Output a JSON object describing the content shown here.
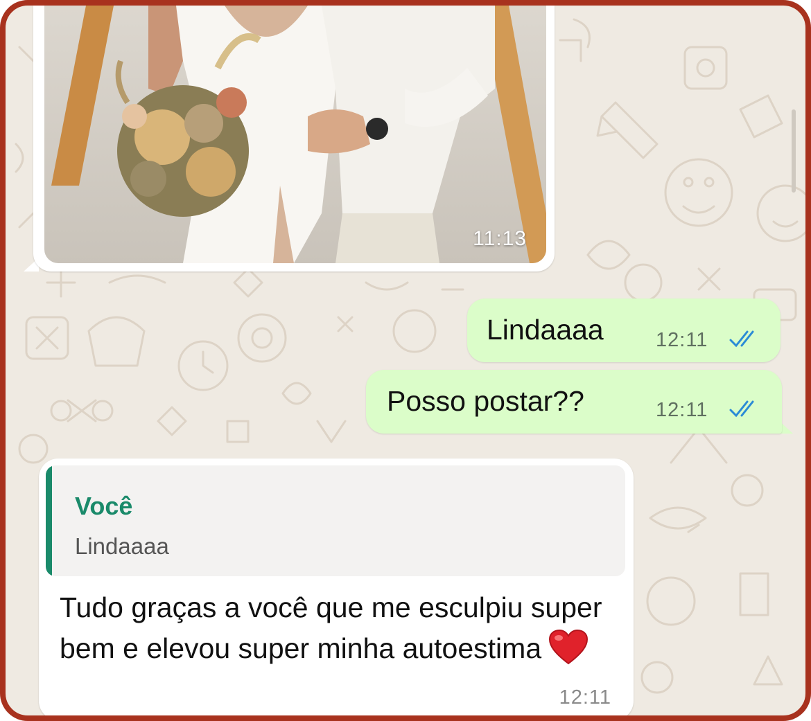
{
  "chat": {
    "image_message": {
      "time": "11:13"
    },
    "outgoing": [
      {
        "text": "Lindaaaa",
        "time": "12:11",
        "status_icon": "double-check-read-icon"
      },
      {
        "text": "Posso postar??",
        "time": "12:11",
        "status_icon": "double-check-read-icon"
      }
    ],
    "reply_message": {
      "quote_author": "Você",
      "quote_text": "Lindaaaa",
      "text": "Tudo graças a você que me esculpiu super bem e elevou super minha autoestima",
      "emoji": "heart-emoji",
      "time": "12:11"
    }
  },
  "colors": {
    "frame_border": "#a8321e",
    "chat_background": "#efeae2",
    "outgoing_bubble": "#dbfdc9",
    "incoming_bubble": "#ffffff",
    "read_ticks": "#2b8bd6",
    "quote_accent": "#1a8a6a"
  }
}
